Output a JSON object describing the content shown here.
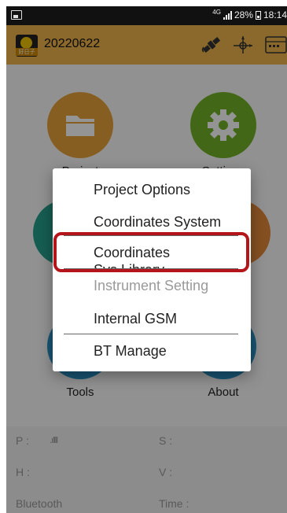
{
  "status_bar": {
    "network": "4G",
    "battery": "28%",
    "time": "18:14"
  },
  "app_bar": {
    "logo_text": "好日子",
    "title": "20220622"
  },
  "main": {
    "tiles": [
      {
        "label": "Project"
      },
      {
        "label": "Settings"
      },
      {
        "label": "Tools"
      },
      {
        "label": "About"
      }
    ]
  },
  "info_panel": {
    "p_label": "P :",
    "s_label": "S :",
    "h_label": "H :",
    "v_label": "V :",
    "bluetooth_label": "Bluetooth",
    "time_label": "Time :"
  },
  "menu": {
    "items": [
      {
        "label": "Project Options",
        "enabled": true
      },
      {
        "label": "Coordinates System",
        "enabled": true
      },
      {
        "label": "Coordinates Sys Library",
        "line1": "Coordinates",
        "line2": "Sys Library",
        "enabled": true,
        "highlighted": true
      },
      {
        "label": "Instrument Setting",
        "enabled": false
      },
      {
        "label": "Internal GSM",
        "enabled": true
      },
      {
        "label": "BT Manage",
        "enabled": true
      }
    ]
  },
  "colors": {
    "app_bar": "#f0b44a",
    "project_tile": "#e8a33a",
    "settings_tile": "#72b429",
    "tools_tile": "#2a93c7",
    "highlight": "#b3151b"
  }
}
